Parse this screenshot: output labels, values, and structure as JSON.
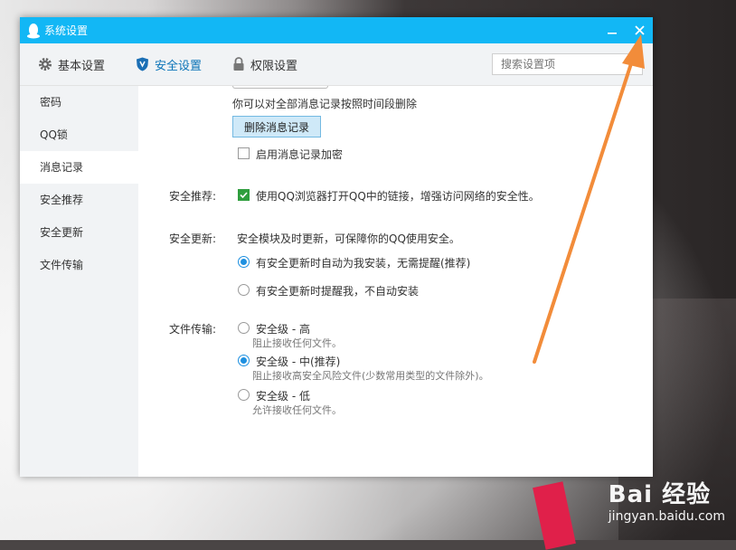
{
  "window": {
    "title": "系统设置"
  },
  "toolbar": {
    "tabs": [
      {
        "label": "基本设置",
        "icon": "gear-icon"
      },
      {
        "label": "安全设置",
        "icon": "shield-icon"
      },
      {
        "label": "权限设置",
        "icon": "lock-icon"
      }
    ],
    "active_tab": "安全设置",
    "search_placeholder": "搜索设置项"
  },
  "sidebar": {
    "items": [
      "密码",
      "QQ锁",
      "消息记录",
      "安全推荐",
      "安全更新",
      "文件传输"
    ],
    "active": "消息记录"
  },
  "message_record": {
    "desc": "你可以对全部消息记录按照时间段删除",
    "delete_button": "删除消息记录",
    "encrypt_label": "启用消息记录加密",
    "encrypt_checked": false
  },
  "security_recommend": {
    "label": "安全推荐:",
    "option": "使用QQ浏览器打开QQ中的链接，增强访问网络的安全性。",
    "checked": true
  },
  "security_update": {
    "label": "安全更新:",
    "desc": "安全模块及时更新，可保障你的QQ使用安全。",
    "options": [
      {
        "label": "有安全更新时自动为我安装，无需提醒(推荐)",
        "selected": true
      },
      {
        "label": "有安全更新时提醒我，不自动安装",
        "selected": false
      }
    ]
  },
  "file_transfer": {
    "label": "文件传输:",
    "options": [
      {
        "label": "安全级 - 高",
        "desc": "阻止接收任何文件。",
        "selected": false
      },
      {
        "label": "安全级 - 中(推荐)",
        "desc": "阻止接收高安全风险文件(少数常用类型的文件除外)。",
        "selected": true
      },
      {
        "label": "安全级 - 低",
        "desc": "允许接收任何文件。",
        "selected": false
      }
    ]
  },
  "watermark": {
    "main": "Bai 经验",
    "sub": "jingyan.baidu.com"
  },
  "colors": {
    "titlebar": "#12b7f5",
    "accent": "#1e90e0",
    "arrow": "#f28c3a"
  }
}
